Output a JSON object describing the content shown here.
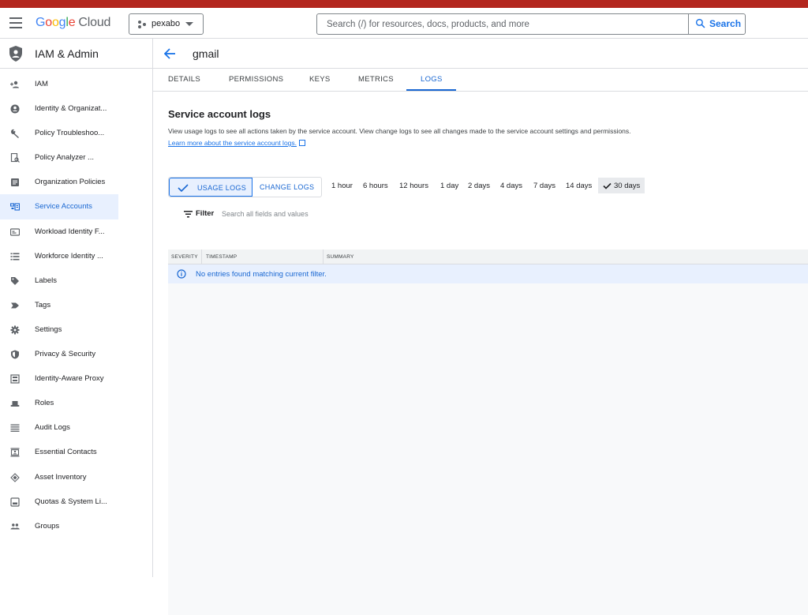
{
  "topbar": {
    "logo_letters": [
      "G",
      "o",
      "o",
      "g",
      "l",
      "e"
    ],
    "logo_suffix": "Cloud",
    "project": "pexabo",
    "search_placeholder": "Search (/) for resources, docs, products, and more",
    "search_button": "Search"
  },
  "sidebar": {
    "title": "IAM & Admin",
    "items": [
      {
        "label": "IAM",
        "icon": "person-add-icon"
      },
      {
        "label": "Identity & Organizat...",
        "icon": "account-circle-icon"
      },
      {
        "label": "Policy Troubleshoo...",
        "icon": "wrench-icon"
      },
      {
        "label": "Policy Analyzer ...",
        "icon": "policy-search-icon"
      },
      {
        "label": "Organization Policies",
        "icon": "article-icon"
      },
      {
        "label": "Service Accounts",
        "icon": "service-account-icon",
        "active": true
      },
      {
        "label": "Workload Identity F...",
        "icon": "id-card-icon"
      },
      {
        "label": "Workforce Identity ...",
        "icon": "list-icon"
      },
      {
        "label": "Labels",
        "icon": "label-tag-icon"
      },
      {
        "label": "Tags",
        "icon": "tag-arrow-icon"
      },
      {
        "label": "Settings",
        "icon": "gear-icon"
      },
      {
        "label": "Privacy & Security",
        "icon": "shield-icon"
      },
      {
        "label": "Identity-Aware Proxy",
        "icon": "proxy-icon"
      },
      {
        "label": "Roles",
        "icon": "hat-icon"
      },
      {
        "label": "Audit Logs",
        "icon": "lines-icon"
      },
      {
        "label": "Essential Contacts",
        "icon": "contact-icon"
      },
      {
        "label": "Asset Inventory",
        "icon": "diamond-icon"
      },
      {
        "label": "Quotas & System Li...",
        "icon": "quota-icon"
      },
      {
        "label": "Groups",
        "icon": "group-icon"
      }
    ]
  },
  "page": {
    "title": "gmail",
    "tabs": [
      "DETAILS",
      "PERMISSIONS",
      "KEYS",
      "METRICS",
      "LOGS"
    ],
    "active_tab": "LOGS"
  },
  "logs": {
    "title": "Service account logs",
    "description": "View usage logs to see all actions taken by the service account. View change logs to see all changes made to the service account settings and permissions.",
    "learn_more": "Learn more about the service account logs.",
    "usage_logs": "USAGE LOGS",
    "change_logs": "CHANGE LOGS",
    "ranges": [
      "1 hour",
      "6 hours",
      "12 hours",
      "1 day",
      "2 days",
      "4 days",
      "7 days",
      "14 days",
      "30 days"
    ],
    "active_range": "30 days",
    "filter_label": "Filter",
    "filter_placeholder": "Search all fields and values",
    "columns": [
      "SEVERITY",
      "TIMESTAMP",
      "SUMMARY"
    ],
    "empty_message": "No entries found matching current filter."
  },
  "colors": {
    "accent": "#1a73e8",
    "active_bg": "#e8f0fe",
    "browser_strip": "#b3261e"
  }
}
